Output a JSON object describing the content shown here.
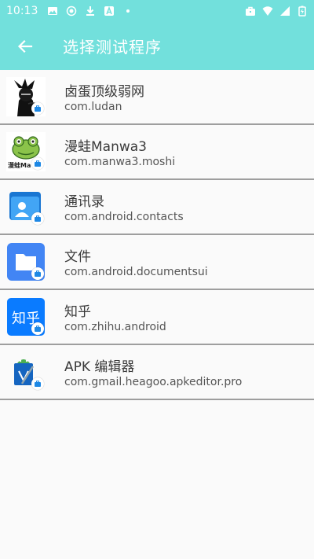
{
  "status_bar": {
    "time": "10:13",
    "icons": [
      "image-icon",
      "location-icon",
      "download-icon",
      "app-a-icon",
      "dot-icon",
      "briefcase-icon",
      "wifi-icon",
      "signal-icon",
      "battery-icon"
    ]
  },
  "app_bar": {
    "title": "选择测试程序",
    "background": "#72e0dc"
  },
  "apps": [
    {
      "name": "卤蛋顶级弱网",
      "package": "com.ludan",
      "icon": "ludan-icon"
    },
    {
      "name": "漫蛙Manwa3",
      "package": "com.manwa3.moshi",
      "icon": "manwa-frog-icon"
    },
    {
      "name": "通讯录",
      "package": "com.android.contacts",
      "icon": "contacts-icon"
    },
    {
      "name": "文件",
      "package": "com.android.documentsui",
      "icon": "folder-icon"
    },
    {
      "name": "知乎",
      "package": "com.zhihu.android",
      "icon": "zhihu-icon"
    },
    {
      "name": "APK 编辑器",
      "package": "com.gmail.heagoo.apkeditor.pro",
      "icon": "apk-editor-icon"
    }
  ],
  "icon_texts": {
    "manwa": "漫蛙Ma",
    "zhihu": "知乎"
  }
}
